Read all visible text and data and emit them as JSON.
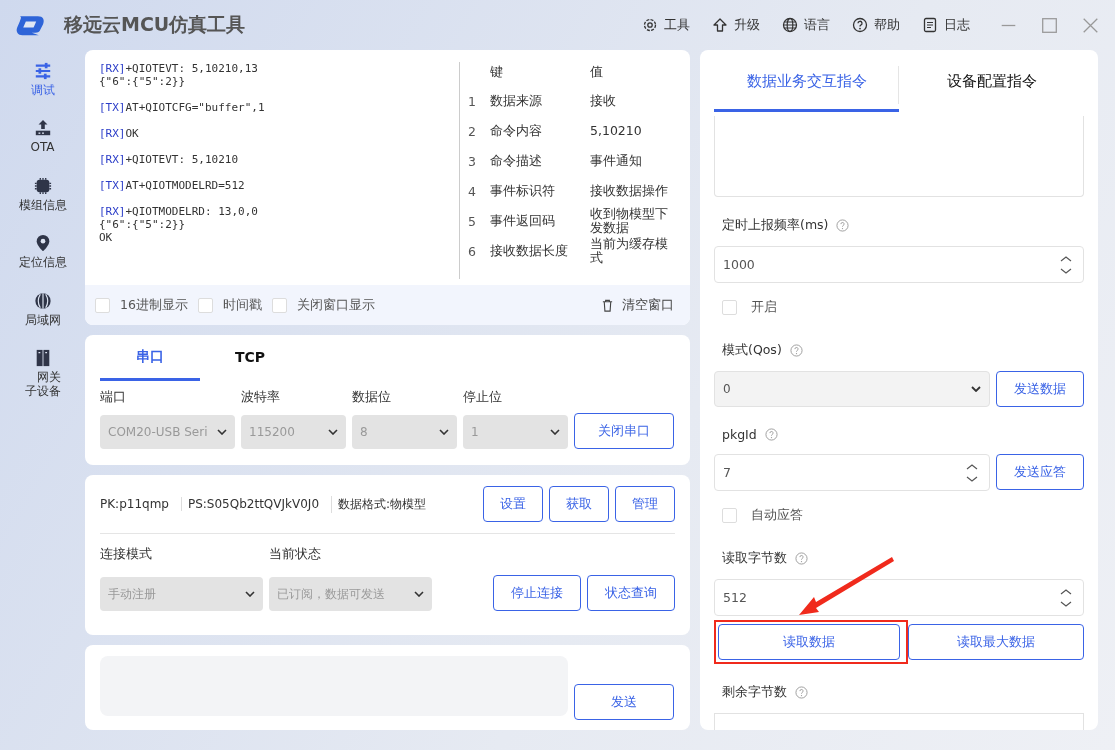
{
  "app": {
    "title": "移远云MCU仿真工具"
  },
  "menu": [
    {
      "label": "工具"
    },
    {
      "label": "升级"
    },
    {
      "label": "语言"
    },
    {
      "label": "帮助"
    },
    {
      "label": "日志"
    }
  ],
  "sidebar": [
    {
      "label": "调试",
      "selected": true
    },
    {
      "label": "OTA",
      "selected": false
    },
    {
      "label": "模组信息",
      "selected": false
    },
    {
      "label": "定位信息",
      "selected": false
    },
    {
      "label": "局域网",
      "selected": false
    },
    {
      "label": "网关子设备",
      "selected": false
    }
  ],
  "log": [
    {
      "tag": "[RX]",
      "lines": [
        "+QIOTEVT: 5,10210,13",
        "{\"6\":{\"5\":2}}"
      ]
    },
    {
      "tag": "[TX]",
      "lines": [
        "AT+QIOTCFG=\"buffer\",1"
      ]
    },
    {
      "tag": "[RX]",
      "lines": [
        "OK"
      ]
    },
    {
      "tag": "[RX]",
      "lines": [
        "+QIOTEVT: 5,10210"
      ]
    },
    {
      "tag": "[TX]",
      "lines": [
        "AT+QIOTMODELRD=512"
      ]
    },
    {
      "tag": "[RX]",
      "lines": [
        "+QIOTMODELRD: 13,0,0",
        "{\"6\":{\"5\":2}}",
        "OK"
      ]
    }
  ],
  "kv_table": {
    "columns": [
      "键",
      "值"
    ],
    "rows": [
      {
        "index": "1",
        "key": "数据来源",
        "value": "接收"
      },
      {
        "index": "2",
        "key": "命令内容",
        "value": " 5,10210"
      },
      {
        "index": "3",
        "key": "命令描述",
        "value": "事件通知"
      },
      {
        "index": "4",
        "key": "事件标识符",
        "value": "接收数据操作"
      },
      {
        "index": "5",
        "key": "事件返回码",
        "value": "收到物模型下发数据"
      },
      {
        "index": "6",
        "key": "接收数据长度",
        "value": "当前为缓存模式"
      }
    ]
  },
  "log_options": [
    {
      "label": "16进制显示",
      "checked": false
    },
    {
      "label": "时间戳",
      "checked": false
    },
    {
      "label": "关闭窗口显示",
      "checked": false
    }
  ],
  "clear_button": "清空窗口",
  "conn_tabs": [
    {
      "label": "串口",
      "selected": true
    },
    {
      "label": "TCP",
      "selected": false
    }
  ],
  "serial": {
    "fields": [
      {
        "label": "端口",
        "value": "COM20-USB Seri",
        "disabled": true
      },
      {
        "label": "波特率",
        "value": "115200",
        "disabled": true
      },
      {
        "label": "数据位",
        "value": "8",
        "disabled": true
      },
      {
        "label": "停止位",
        "value": "1",
        "disabled": true
      }
    ],
    "button": "关闭串口"
  },
  "product": {
    "info": [
      "PK:p11qmp",
      "PS:S05Qb2ttQVJkV0J0",
      "数据格式:物模型"
    ],
    "buttons": [
      "设置",
      "获取",
      "管理"
    ],
    "fields": [
      {
        "label": "连接模式",
        "value": "手动注册",
        "disabled": true
      },
      {
        "label": "当前状态",
        "value": "已订阅，数据可发送",
        "disabled": true
      }
    ],
    "actions": [
      "停止连接",
      "状态查询"
    ]
  },
  "send": {
    "button": "发送"
  },
  "right_tabs": [
    {
      "label": "数据业务交互指令",
      "selected": true
    },
    {
      "label": "设备配置指令",
      "selected": false
    }
  ],
  "right_items": [
    {
      "kind": "textarea"
    },
    {
      "kind": "label",
      "text": "定时上报频率(ms)"
    },
    {
      "kind": "number",
      "value": "1000"
    },
    {
      "kind": "checkbox",
      "label": "开启",
      "checked": false
    },
    {
      "kind": "label",
      "text": "模式(Qos)"
    },
    {
      "kind": "select",
      "value": "0",
      "button": "发送数据"
    },
    {
      "kind": "label",
      "text": "pkgId"
    },
    {
      "kind": "number",
      "value": "7",
      "button": "发送应答"
    },
    {
      "kind": "checkbox",
      "label": "自动应答",
      "checked": false
    },
    {
      "kind": "label",
      "text": "读取字节数"
    },
    {
      "kind": "number",
      "value": "512"
    },
    {
      "kind": "buttons",
      "buttons": [
        {
          "label": "读取数据",
          "highlighted": true
        },
        {
          "label": "读取最大数据",
          "highlighted": false
        }
      ]
    },
    {
      "kind": "label",
      "text": "剩余字节数"
    },
    {
      "kind": "field"
    }
  ]
}
